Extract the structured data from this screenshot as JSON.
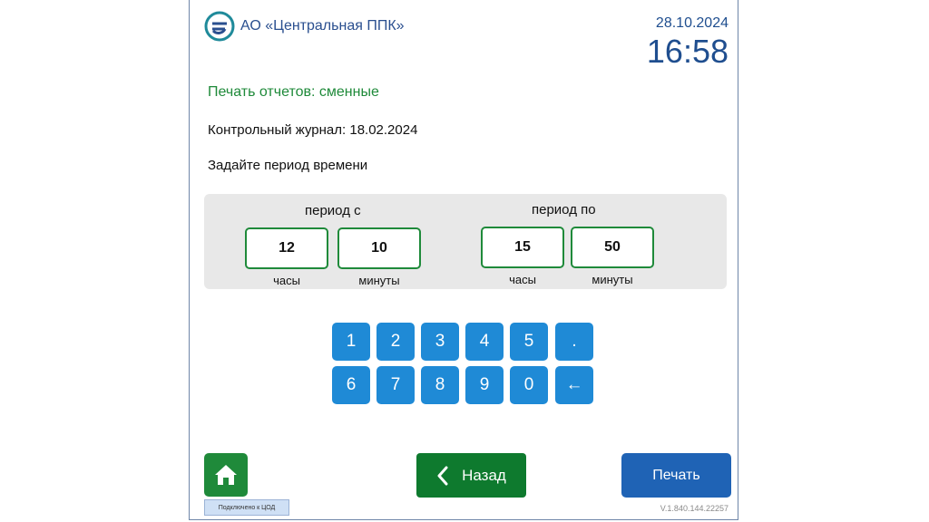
{
  "header": {
    "company": "АО «Центральная ППК»",
    "date": "28.10.2024",
    "time": "16:58"
  },
  "content": {
    "section_title": "Печать отчетов: сменные",
    "journal": "Контрольный журнал: 18.02.2024",
    "prompt": "Задайте период времени"
  },
  "period_from": {
    "label": "период с",
    "hours": "12",
    "minutes": "10",
    "hours_caption": "часы",
    "minutes_caption": "минуты"
  },
  "period_to": {
    "label": "период по",
    "hours": "15",
    "minutes": "50",
    "hours_caption": "часы",
    "minutes_caption": "минуты"
  },
  "keypad": [
    "1",
    "2",
    "3",
    "4",
    "5",
    ".",
    "6",
    "7",
    "8",
    "9",
    "0",
    "←"
  ],
  "footer": {
    "status": "Подключено к ЦОД",
    "back_label": "Назад",
    "print_label": "Печать",
    "version": "V.1.840.144.22257"
  },
  "colors": {
    "green": "#1f8a3a",
    "blue_key": "#1f8ad6",
    "blue_dark": "#1f4e8f"
  }
}
